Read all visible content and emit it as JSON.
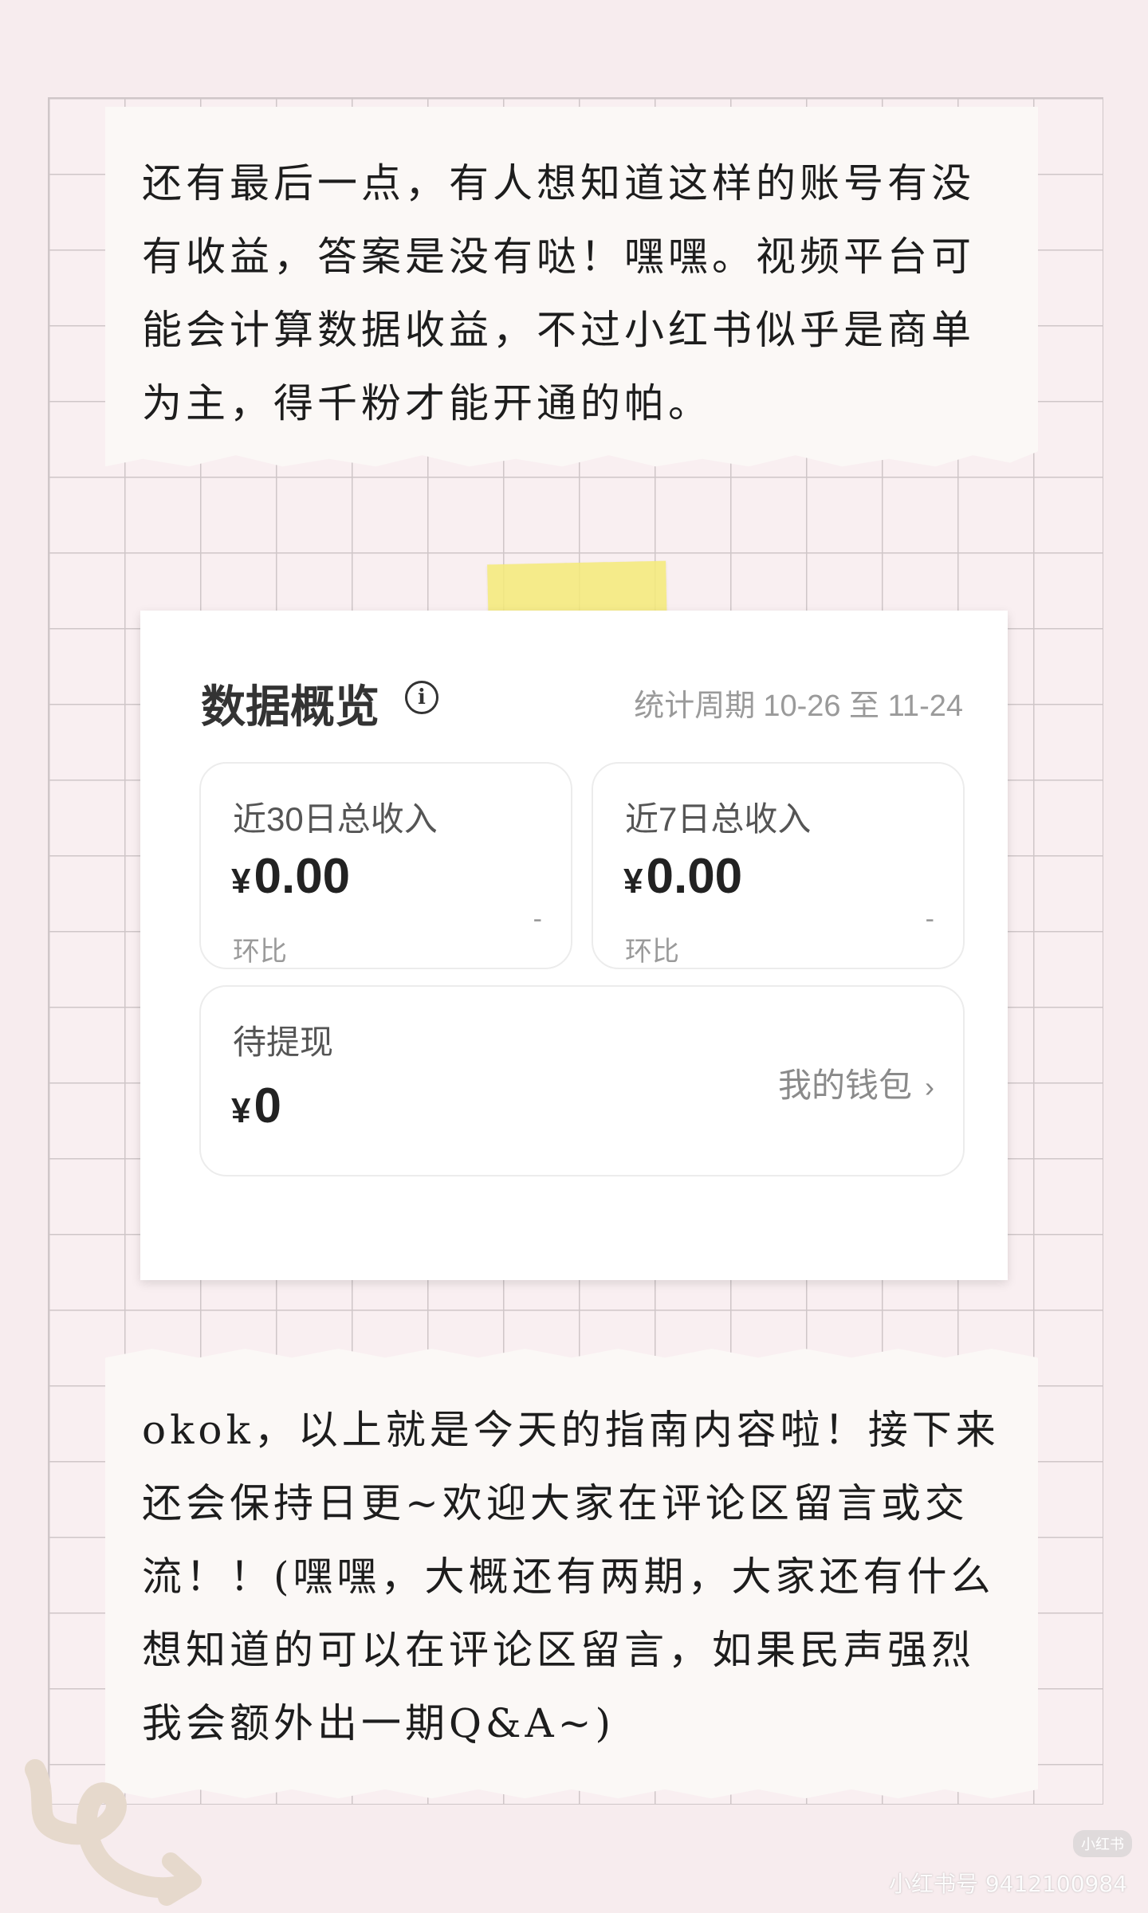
{
  "notes": {
    "top_text": "还有最后一点，有人想知道这样的账号有没有收益，答案是没有哒！嘿嘿。视频平台可能会计算数据收益，不过小红书似乎是商单为主，得千粉才能开通的帕。",
    "bottom_text": "okok，以上就是今天的指南内容啦！接下来还会保持日更~欢迎大家在评论区留言或交流！！(嘿嘿，大概还有两期，大家还有什么想知道的可以在评论区留言，如果民声强烈我会额外出一期Q&A~)"
  },
  "overview": {
    "title": "数据概览",
    "info_icon": "info-icon",
    "period_label": "统计周期",
    "period_range": "10-26 至 11-24",
    "cards": {
      "thirty_day": {
        "label": "近30日总收入",
        "currency": "¥",
        "amount": "0.00",
        "sub_label": "环比",
        "change": "-"
      },
      "seven_day": {
        "label": "近7日总收入",
        "currency": "¥",
        "amount": "0.00",
        "sub_label": "环比",
        "change": "-"
      },
      "pending": {
        "label": "待提现",
        "currency": "¥",
        "amount": "0",
        "wallet_link": "我的钱包",
        "chevron": "›"
      }
    }
  },
  "watermark": {
    "badge": "小红书",
    "id_text": "小红书号 9412100984"
  },
  "colors": {
    "background": "#f7ecee",
    "tape": "#f5ea78",
    "card_border": "#ececec"
  }
}
